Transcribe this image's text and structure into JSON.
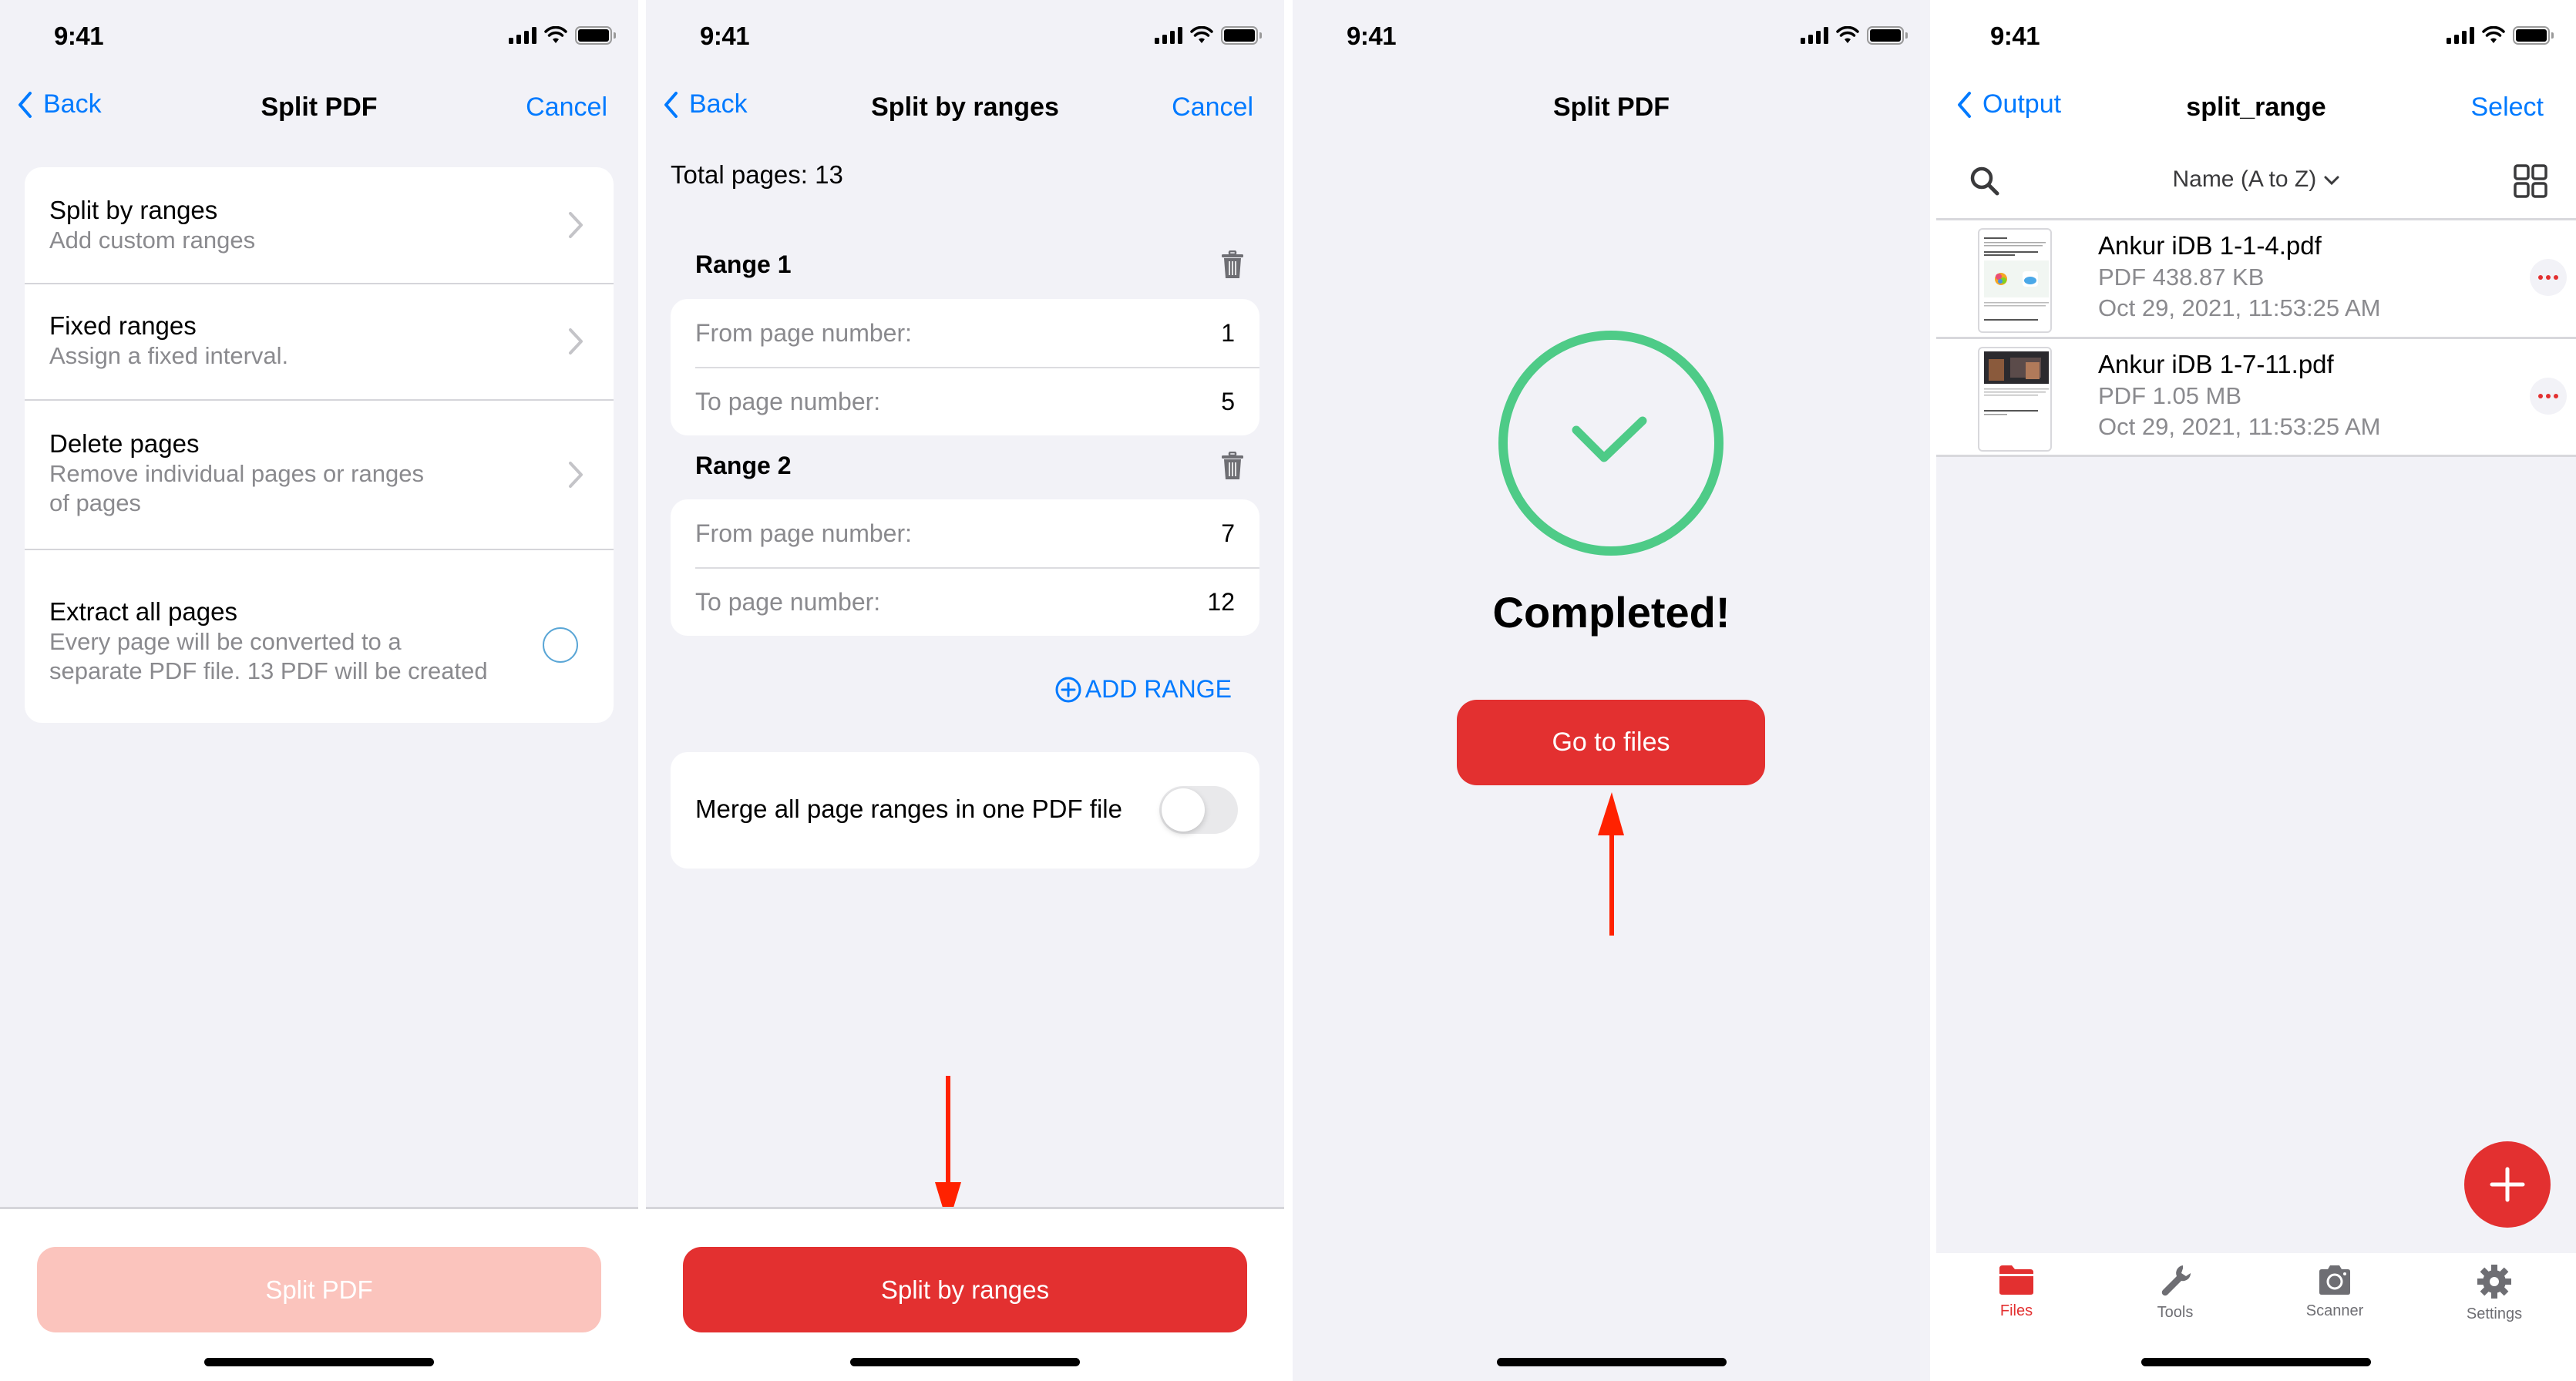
{
  "status_bar": {
    "time": "9:41"
  },
  "colors": {
    "accent_red": "#e33030",
    "accent_red_disabled": "#fbc4bd",
    "link_blue": "#007aff",
    "success_green": "#4ecb87",
    "annotation_arrow": "#ff2200"
  },
  "screen1": {
    "nav": {
      "back_label": "Back",
      "title": "Split PDF",
      "right_label": "Cancel"
    },
    "options": [
      {
        "title": "Split by ranges",
        "subtitle": "Add custom ranges",
        "accessory": "chevron-right"
      },
      {
        "title": "Fixed ranges",
        "subtitle": "Assign a fixed interval.",
        "accessory": "chevron-right"
      },
      {
        "title": "Delete pages",
        "subtitle_line1": "Remove individual pages or ranges",
        "subtitle_line2": "of pages",
        "accessory": "chevron-right"
      },
      {
        "title": "Extract all pages",
        "subtitle_line1": "Every page will be converted to a",
        "subtitle_line2": "separate PDF file. 13 PDF will be created",
        "accessory": "radio",
        "selected": false
      }
    ],
    "action_button": {
      "label": "Split PDF",
      "enabled": false
    }
  },
  "screen2": {
    "nav": {
      "back_label": "Back",
      "title": "Split by ranges",
      "right_label": "Cancel"
    },
    "total_pages_label": "Total pages: 13",
    "ranges": [
      {
        "label": "Range 1",
        "from_label": "From page number:",
        "from_value": "1",
        "to_label": "To page number:",
        "to_value": "5"
      },
      {
        "label": "Range 2",
        "from_label": "From page number:",
        "from_value": "7",
        "to_label": "To page number:",
        "to_value": "12"
      }
    ],
    "add_range_label": "ADD RANGE",
    "merge": {
      "label": "Merge all page ranges in one PDF file",
      "on": false
    },
    "action_button": {
      "label": "Split by ranges",
      "enabled": true
    }
  },
  "screen3": {
    "nav": {
      "title": "Split PDF"
    },
    "status_title": "Completed!",
    "action_button": {
      "label": "Go to files"
    }
  },
  "screen4": {
    "nav": {
      "back_label": "Output",
      "title": "split_range",
      "right_label": "Select"
    },
    "sort_label": "Name (A to Z)",
    "files": [
      {
        "name": "Ankur iDB 1-1-4.pdf",
        "size": "PDF 438.87 KB",
        "date": "Oct 29, 2021, 11:53:25 AM"
      },
      {
        "name": "Ankur iDB 1-7-11.pdf",
        "size": "PDF 1.05 MB",
        "date": "Oct 29, 2021, 11:53:25 AM"
      }
    ],
    "tabs": [
      {
        "label": "Files",
        "icon": "folder-icon",
        "active": true
      },
      {
        "label": "Tools",
        "icon": "wrench-icon",
        "active": false
      },
      {
        "label": "Scanner",
        "icon": "camera-icon",
        "active": false
      },
      {
        "label": "Settings",
        "icon": "gear-icon",
        "active": false
      }
    ]
  }
}
